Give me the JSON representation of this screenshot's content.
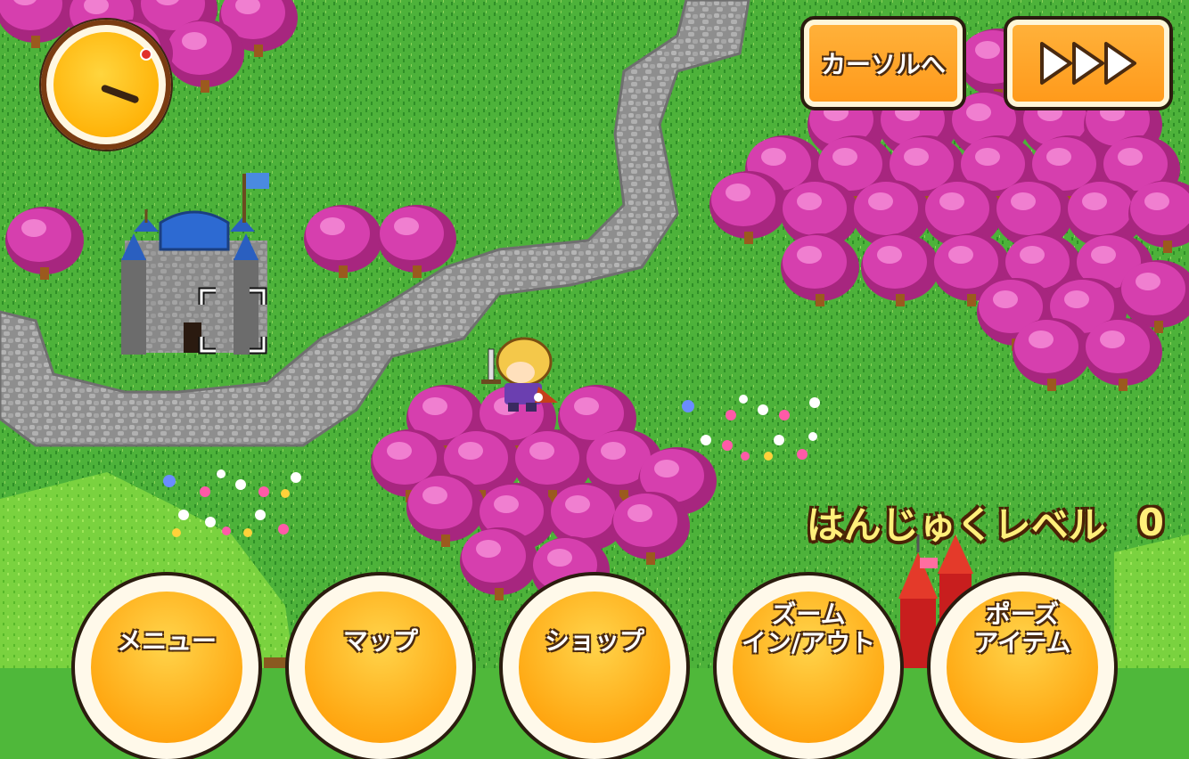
{
  "top_buttons": {
    "cursor_label": "カーソルへ",
    "fast_forward": "fast-forward-icon"
  },
  "hud": {
    "level_label": "はんじゅくレベル",
    "level_value": "0"
  },
  "bottom_menu": {
    "menu": "メニュー",
    "map": "マップ",
    "shop": "ショップ",
    "zoom_line1": "ズーム",
    "zoom_line2": "イン/アウト",
    "pause_line1": "ポーズ",
    "pause_line2": "アイテム"
  },
  "colors": {
    "grass": "#4fb83a",
    "road": "#9a9a9a",
    "tree": "#d53aa8",
    "button": "#ff9a1b"
  }
}
